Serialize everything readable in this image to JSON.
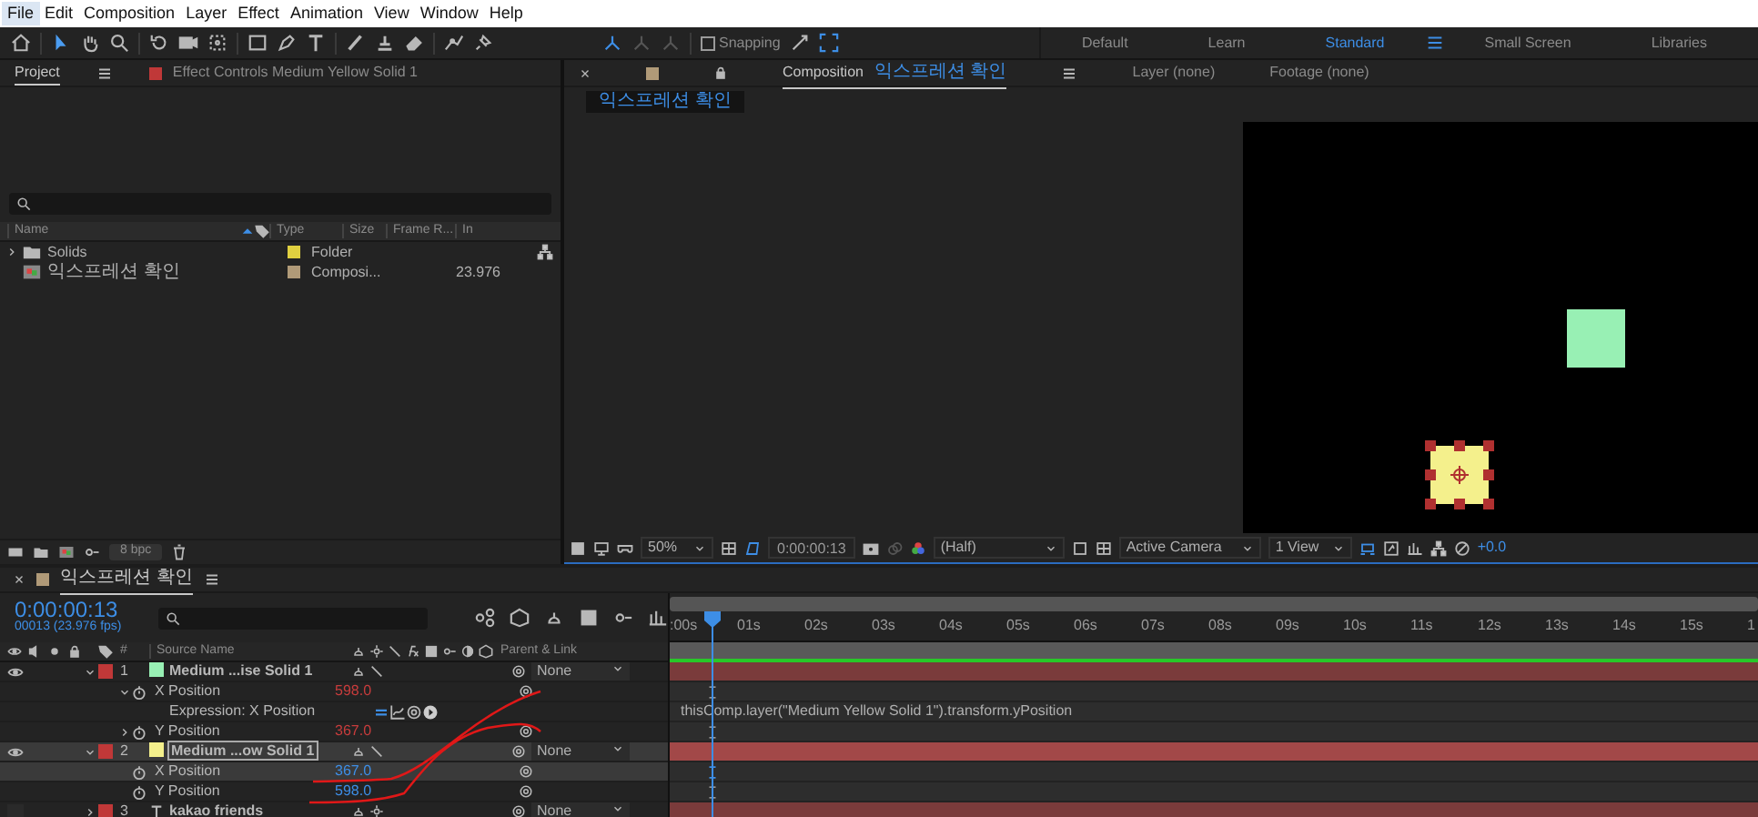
{
  "menu": [
    {
      "label": "File",
      "selected": true
    },
    {
      "label": "Edit",
      "selected": false
    },
    {
      "label": "Composition",
      "selected": false
    },
    {
      "label": "Layer",
      "selected": false
    },
    {
      "label": "Effect",
      "selected": false
    },
    {
      "label": "Animation",
      "selected": false
    },
    {
      "label": "View",
      "selected": false
    },
    {
      "label": "Window",
      "selected": false
    },
    {
      "label": "Help",
      "selected": false
    }
  ],
  "toolbar": {
    "snapping": {
      "label": "Snapping",
      "checked": false
    }
  },
  "workspaces": [
    {
      "label": "Default",
      "selected": false
    },
    {
      "label": "Learn",
      "selected": false
    },
    {
      "label": "Standard",
      "selected": true
    },
    {
      "label": "Small Screen",
      "selected": false
    },
    {
      "label": "Libraries",
      "selected": false
    }
  ],
  "project_panel": {
    "tabs": [
      {
        "label": "Project",
        "selected": true
      },
      {
        "label": "Effect Controls Medium Yellow Solid 1",
        "selected": false,
        "color": "#c03838"
      }
    ],
    "columns": [
      "Name",
      "Type",
      "Size",
      "Frame R...",
      "In"
    ],
    "items": [
      {
        "name": "Solids",
        "kind": "folder",
        "color": "#e0d040",
        "type": "Folder"
      },
      {
        "name": "익스프레션 확인",
        "kind": "composition",
        "color": "#b09a78",
        "type": "Composi...",
        "frame_rate": "23.976"
      }
    ],
    "footer": {
      "bit_depth": "8 bpc"
    }
  },
  "composition_panel": {
    "tabs": [
      {
        "kind": "composition",
        "prefix": "Composition",
        "label": "익스프레션 확인",
        "selected": true,
        "color": "#b09a78"
      },
      {
        "kind": "layer",
        "label": "Layer (none)",
        "selected": false
      },
      {
        "kind": "footage",
        "label": "Footage (none)",
        "selected": false
      }
    ],
    "breadcrumb": "익스프레션 확인",
    "viewer_toolbar": {
      "magnification": "50%",
      "timecode": "0:00:00:13",
      "resolution": "(Half)",
      "camera": "Active Camera",
      "views": "1 View",
      "exposure": "+0.0"
    }
  },
  "timeline": {
    "tab": {
      "label": "익스프레션 확인",
      "color": "#b09a78"
    },
    "current_time": "0:00:00:13",
    "frame_info": "00013 (23.976 fps)",
    "columns": {
      "number": "#",
      "source_name": "Source Name",
      "parent": "Parent & Link"
    },
    "ruler": [
      ":00s",
      "01s",
      "02s",
      "03s",
      "04s",
      "05s",
      "06s",
      "07s",
      "08s",
      "09s",
      "10s",
      "11s",
      "12s",
      "13s",
      "14s",
      "15s",
      "1"
    ],
    "playhead": {
      "level": 0.039
    },
    "layers": [
      {
        "number": "1",
        "name": "Medium ...ise Solid 1",
        "kind": "solid",
        "color": "#98f0b4",
        "visible": true,
        "expanded": true,
        "selected": false,
        "parent": "None",
        "properties": [
          {
            "name": "X Position",
            "value": "598.0",
            "driven": true,
            "expanded": true,
            "selected": false,
            "expression": {
              "label": "Expression: X Position",
              "code": "thisComp.layer(\"Medium Yellow Solid 1\").transform.yPosition"
            }
          },
          {
            "name": "Y Position",
            "value": "367.0",
            "driven": true,
            "expanded": false,
            "selected": false
          }
        ]
      },
      {
        "number": "2",
        "name": "Medium ...ow Solid 1",
        "kind": "solid",
        "color": "#f4f08c",
        "visible": true,
        "expanded": true,
        "selected": true,
        "parent": "None",
        "properties": [
          {
            "name": "X Position",
            "value": "367.0",
            "driven": false,
            "selected": true
          },
          {
            "name": "Y Position",
            "value": "598.0",
            "driven": false,
            "selected": false
          }
        ]
      },
      {
        "number": "3",
        "name": "kakao friends",
        "kind": "text",
        "visible": false,
        "expanded": false,
        "selected": false,
        "parent": "None"
      }
    ]
  }
}
